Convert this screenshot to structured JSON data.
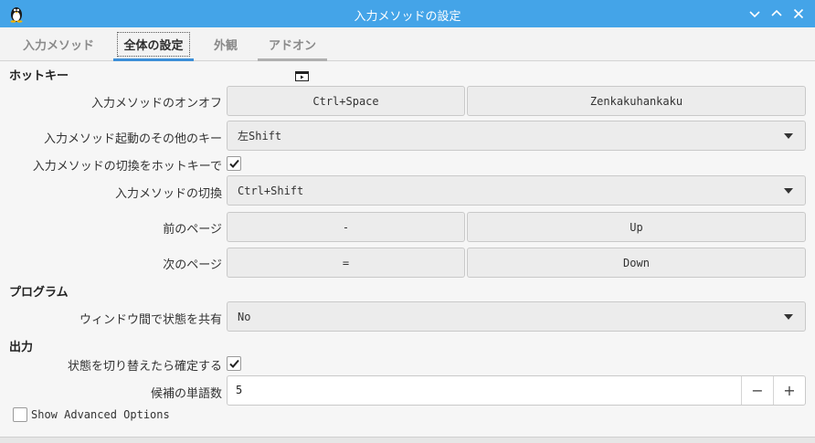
{
  "window": {
    "title": "入力メソッドの設定",
    "accent": "#44a4e8"
  },
  "tabs": [
    {
      "label": "入力メソッド"
    },
    {
      "label": "全体の設定"
    },
    {
      "label": "外観"
    },
    {
      "label": "アドオン"
    }
  ],
  "sections": {
    "hotkey": "ホットキー",
    "program": "プログラム",
    "output": "出力"
  },
  "rows": {
    "toggle": {
      "label": "入力メソッドのオンオフ",
      "key1": "Ctrl+Space",
      "key2": "Zenkakuhankaku"
    },
    "other_keys": {
      "label": "入力メソッド起動のその他のキー",
      "value": "左Shift"
    },
    "enum_hotkey": {
      "label": "入力メソッドの切換をホットキーで",
      "checked": true
    },
    "switch": {
      "label": "入力メソッドの切換",
      "value": "Ctrl+Shift"
    },
    "prev_page": {
      "label": "前のページ",
      "key1": "-",
      "key2": "Up"
    },
    "next_page": {
      "label": "次のページ",
      "key1": "=",
      "key2": "Down"
    },
    "share_state": {
      "label": "ウィンドウ間で状態を共有",
      "value": "No"
    },
    "commit_on_switch": {
      "label": "状態を切り替えたら確定する",
      "checked": true
    },
    "candidates": {
      "label": "候補の単語数",
      "value": "5",
      "minus": "−",
      "plus": "+"
    }
  },
  "advanced": {
    "label": "Show Advanced Options",
    "checked": false
  },
  "icons": {
    "app": "tux-icon",
    "minimize": "chevron-down-icon",
    "maximize": "chevron-up-icon",
    "close": "close-icon"
  }
}
